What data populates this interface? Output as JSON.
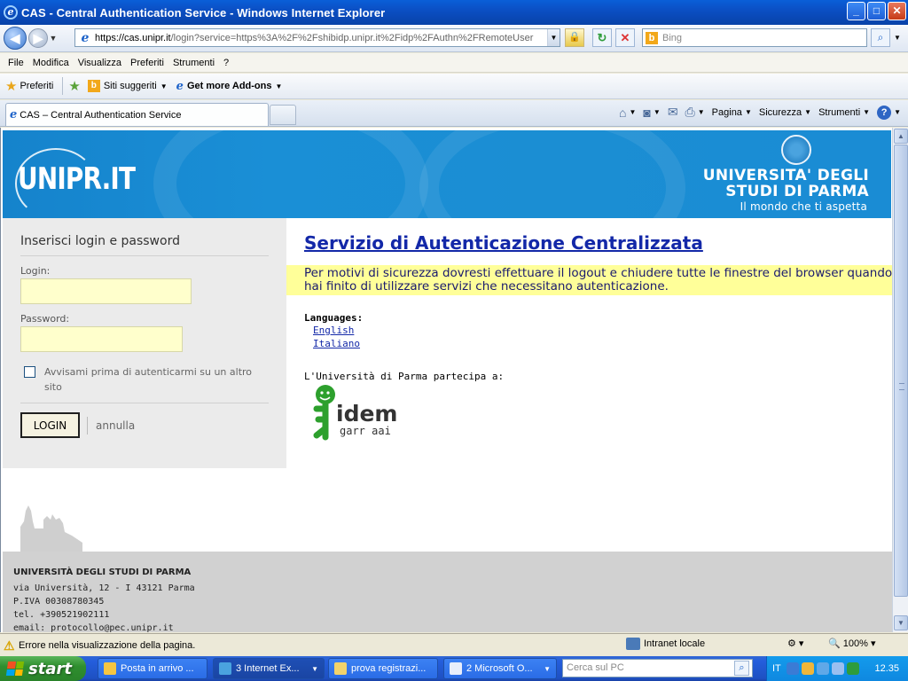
{
  "window": {
    "title": "CAS - Central Authentication Service - Windows Internet Explorer",
    "min_label": "_",
    "max_label": "□",
    "close_label": "✕"
  },
  "addressbar": {
    "url_prefix": "https://",
    "url_host": "cas.unipr.it",
    "url_rest": "/login?service=https%3A%2F%2Fshibidp.unipr.it%2Fidp%2FAuthn%2FRemoteUser",
    "search_placeholder": "Bing"
  },
  "menu": [
    "File",
    "Modifica",
    "Visualizza",
    "Preferiti",
    "Strumenti",
    "?"
  ],
  "favorites_bar": {
    "favorites_label": "Preferiti",
    "suggested_label": "Siti suggeriti",
    "addons_label": "Get more Add-ons"
  },
  "tab": {
    "label": "CAS – Central Authentication Service"
  },
  "command_bar": {
    "page_label": "Pagina",
    "security_label": "Sicurezza",
    "tools_label": "Strumenti"
  },
  "banner": {
    "site_logo": "UNIPR.IT",
    "university_name_line1": "UNIVERSITA' DEGLI",
    "university_name_line2": "STUDI DI PARMA",
    "tagline": "Il mondo che ti aspetta"
  },
  "login": {
    "heading": "Inserisci login e password",
    "login_label": "Login:",
    "login_value": "",
    "password_label": "Password:",
    "password_value": "",
    "warn_label": "Avvisami prima di autenticarmi su un altro sito",
    "login_button": "LOGIN",
    "cancel_link": "annulla"
  },
  "content": {
    "title": "Servizio di Autenticazione Centralizzata",
    "warning": "Per motivi di sicurezza dovresti effettuare il logout e chiudere tutte le finestre del browser quando hai finito di utilizzare servizi che necessitano autenticazione.",
    "languages_heading": "Languages:",
    "languages": [
      "English",
      "Italiano"
    ],
    "partecipa": "L'Università di Parma partecipa a:",
    "idem_logo_text": "idem",
    "idem_sub_text": "garr aai"
  },
  "footer": {
    "name": "UNIVERSITÀ DEGLI STUDI DI PARMA",
    "address": "via Università, 12 - I 43121 Parma",
    "piva": "P.IVA 00308780345",
    "tel": "tel. +390521902111",
    "email": "email: protocollo@pec.unipr.it"
  },
  "statusbar": {
    "message": "Errore nella visualizzazione della pagina.",
    "zone": "Intranet locale",
    "zoom": "100%"
  },
  "taskbar": {
    "start": "start",
    "items": [
      "Posta in arrivo ...",
      "3 Internet Ex...",
      "prova registrazi...",
      "2 Microsoft O..."
    ],
    "search_placeholder": "Cerca sul PC",
    "lang": "IT",
    "clock": "12.35"
  },
  "colors": {
    "banner_blue": "#1a8cd4",
    "title_link": "#1328a8",
    "warning_bg": "#ffff99",
    "input_bg": "#ffffcc",
    "idem_green": "#2da02d"
  }
}
